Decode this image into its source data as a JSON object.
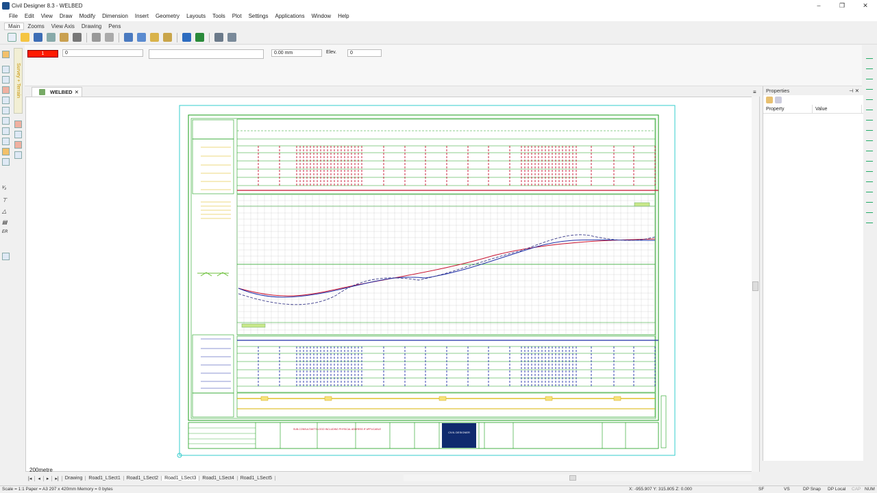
{
  "window": {
    "title": "Civil Designer 8.3 - WELBED"
  },
  "menu": [
    "File",
    "Edit",
    "View",
    "Draw",
    "Modify",
    "Dimension",
    "Insert",
    "Geometry",
    "Layouts",
    "Tools",
    "Plot",
    "Settings",
    "Applications",
    "Window",
    "Help"
  ],
  "ribbon_tabs": [
    "Main",
    "Zooms",
    "View Axis",
    "Drawing",
    "Pens"
  ],
  "props_bar": {
    "color_value": "1",
    "layer_value": "0",
    "width_value": "0.00 mm",
    "elev_label": "Elev.",
    "elev_value": "0"
  },
  "left_panel": {
    "survey_tab": "Survey + Terrain"
  },
  "document_tab": {
    "label": "WELBED"
  },
  "properties_panel": {
    "title": "Properties",
    "col_property": "Property",
    "col_value": "Value"
  },
  "canvas": {
    "scale_label": "200metre"
  },
  "sheet_tabs": [
    "Drawing",
    "Road1_LSect1",
    "Road1_LSect2",
    "Road1_LSect3",
    "Road1_LSect4",
    "Road1_LSect5"
  ],
  "active_sheet": "Road1_LSect3",
  "status": {
    "left": "Scale = 1:1  Paper = A3 297 x 420mm  Memory = 0 bytes",
    "coords": "X: -955.907 Y: 315.805 Z: 0.000",
    "items": [
      "SF",
      "VS",
      "DP Snap",
      "DP Local",
      "CAP",
      "NUM"
    ]
  },
  "drawing": {
    "title_block": {
      "company": "CIVIL DESIGNER",
      "sub_consultant": "SUB-CONSULTANT'S LOGO INCLUDING PHYSICAL ADDRESS IF APPLICABLE"
    }
  },
  "colors": {
    "accent_red": "#ff1a00",
    "grid_green": "#1a9e1a",
    "profile_blue": "#1f2fa8",
    "profile_red": "#c8102e"
  }
}
